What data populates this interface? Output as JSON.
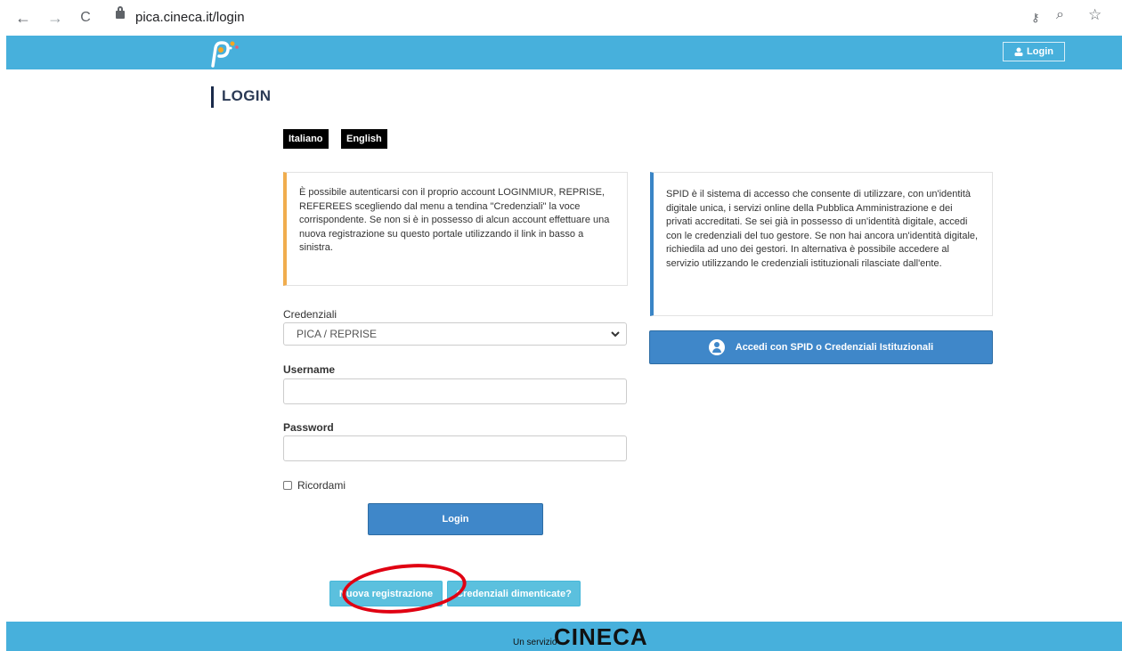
{
  "browser": {
    "url": "pica.cineca.it/login",
    "nav": {
      "back": "←",
      "forward": "→",
      "reload": "C"
    }
  },
  "header": {
    "login_label": "Login"
  },
  "page": {
    "title": "LOGIN",
    "languages": [
      "Italiano",
      "English"
    ]
  },
  "info_left": "È possibile autenticarsi con il proprio account LOGINMIUR, REPRISE, REFEREES scegliendo dal menu a tendina \"Credenziali\" la voce corrispondente. Se non si è in possesso di alcun account effettuare una nuova registrazione su questo portale utilizzando il link in basso a sinistra.",
  "info_right": "SPID è il sistema di accesso che consente di utilizzare, con un'identità digitale unica, i servizi online della Pubblica Amministrazione e dei privati accreditati. Se sei già in possesso di un'identità digitale, accedi con le credenziali del tuo gestore. Se non hai ancora un'identità digitale, richiedila ad uno dei gestori. In alternativa è possibile accedere al servizio utilizzando le credenziali istituzionali rilasciate dall'ente.",
  "form": {
    "credentials_label": "Credenziali",
    "credentials_value": "PICA / REPRISE",
    "username_label": "Username",
    "username_value": "",
    "password_label": "Password",
    "password_value": "",
    "remember_label": "Ricordami",
    "login_button": "Login"
  },
  "spid_button": "Accedi con SPID o Credenziali Istituzionali",
  "bottom_buttons": {
    "new_registration": "Nuova registrazione",
    "forgot_credentials": "Credenziali dimenticate?"
  },
  "footer": {
    "prefix": "Un servizio",
    "brand": "CINECA"
  },
  "colors": {
    "header_bg": "#47b0dc",
    "primary_button": "#3f87c9",
    "light_button": "#5bc0de",
    "annotation": "#e00012"
  }
}
